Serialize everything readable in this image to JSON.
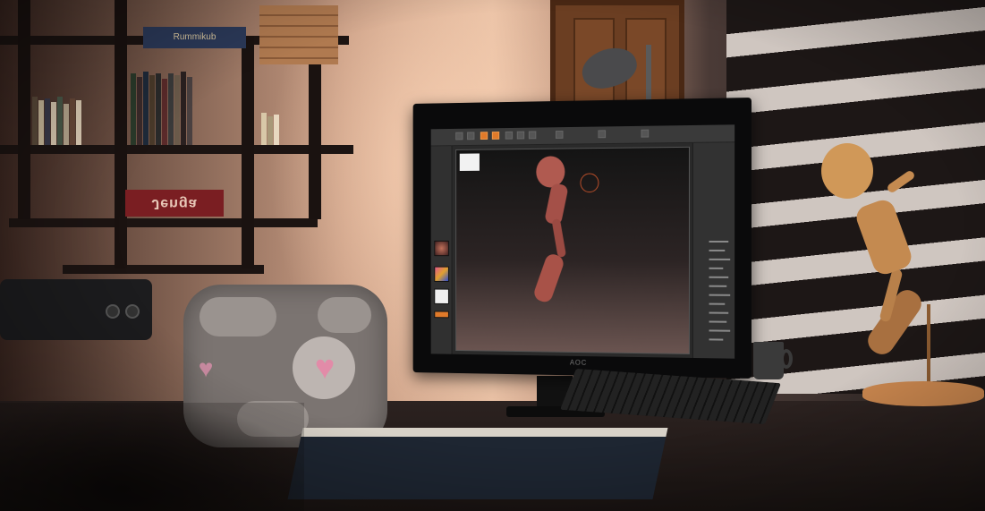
{
  "scene": {
    "monitor_brand": "AOC",
    "bookshelf_box_label": "Jenga",
    "bookshelf_top_box_label": "Rummikub"
  },
  "colors": {
    "accent_orange": "#e07a2a",
    "sculpt_clay": "#b05a50",
    "wall_warm": "#e8c0a4",
    "figurine_tan": "#d09858",
    "cube_heart_pink": "#e28ba8"
  },
  "icons": {
    "heart": "♥"
  }
}
